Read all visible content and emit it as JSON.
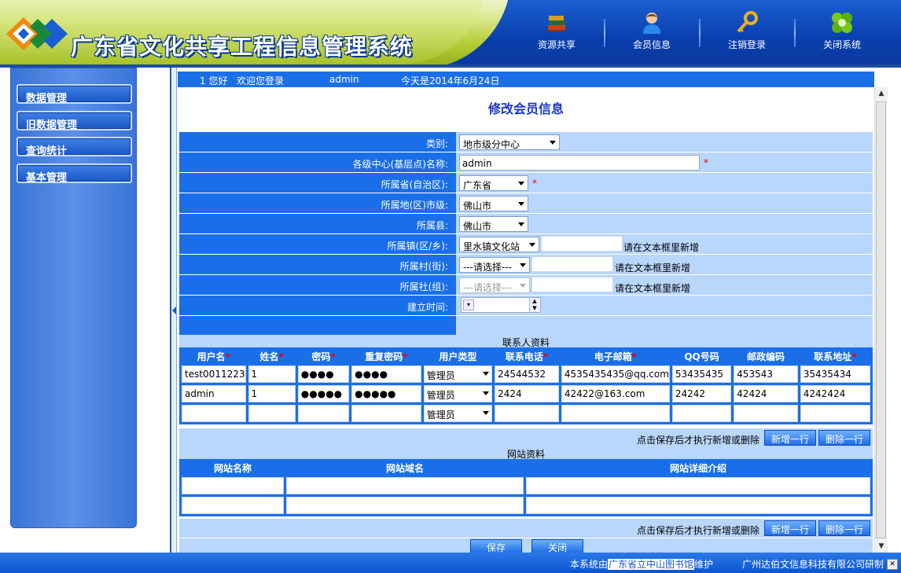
{
  "app": {
    "title": "广东省文化共享工程信息管理系统"
  },
  "topnav": [
    {
      "label": "资源共享",
      "icon": "books-icon"
    },
    {
      "label": "会员信息",
      "icon": "user-icon"
    },
    {
      "label": "注销登录",
      "icon": "key-icon"
    },
    {
      "label": "关闭系统",
      "icon": "close-system-icon"
    }
  ],
  "sidebar": {
    "items": [
      {
        "label": "数据管理"
      },
      {
        "label": "旧数据管理"
      },
      {
        "label": "查询统计"
      },
      {
        "label": "基本管理"
      }
    ]
  },
  "welcome": {
    "user_prefix": "1 您好",
    "greeting": "欢迎您登录",
    "username": "admin",
    "date": "今天是2014年6月24日"
  },
  "page": {
    "title": "修改会员信息"
  },
  "form": {
    "category_label": "类别:",
    "category_value": "地市级分中心",
    "center_name_label": "各级中心(基层点)名称:",
    "center_name_value": "admin",
    "province_label": "所属省(自治区):",
    "province_value": "广东省",
    "city_label": "所属地(区)市级:",
    "city_value": "佛山市",
    "county_label": "所属县:",
    "county_value": "佛山市",
    "town_label": "所属镇(区/乡):",
    "town_value": "里水镇文化站",
    "village_label": "所属村(街):",
    "village_value": "---请选择---",
    "community_label": "所属社(组):",
    "community_value": "---请选择---",
    "established_label": "建立时间:",
    "add_hint": "请在文本框里新增",
    "required_mark": "*"
  },
  "contacts": {
    "section_title": "联系人资料",
    "headers": [
      "用户名",
      "姓名",
      "密码",
      "重复密码",
      "用户类型",
      "联系电话",
      "电子邮箱",
      "QQ号码",
      "邮政编码",
      "联系地址"
    ],
    "required_cols": [
      true,
      true,
      true,
      true,
      false,
      true,
      true,
      false,
      false,
      true
    ],
    "rows": [
      [
        "test0011223",
        "1",
        "●●●●",
        "●●●●",
        "管理员",
        "24544532",
        "4535435435@qq.com",
        "53435435",
        "453543",
        "35435434"
      ],
      [
        "admin",
        "1",
        "●●●●●",
        "●●●●●",
        "管理员",
        "2424",
        "42422@163.com",
        "24242",
        "42424",
        "4242424"
      ],
      [
        "",
        "",
        "",
        "",
        "管理员",
        "",
        "",
        "",
        "",
        ""
      ]
    ],
    "action_hint": "点击保存后才执行新增或删除",
    "add_row_label": "新增一行",
    "delete_row_label": "删除一行"
  },
  "websites": {
    "section_title": "网站资料",
    "headers": [
      "网站名称",
      "网站域名",
      "网站详细介绍"
    ],
    "action_hint": "点击保存后才执行新增或删除",
    "add_row_label": "新增一行",
    "delete_row_label": "删除一行"
  },
  "buttons": {
    "save": "保存",
    "close": "关闭"
  },
  "footer": {
    "maintained_prefix": "本系统由",
    "library": "广东省立中山图书馆",
    "maintained_suffix": "维护",
    "developer": "广州达伯文信息科技有限公司研制"
  },
  "colors": {
    "header_blue": "#0a3fae",
    "accent_blue": "#1a6fe8",
    "row_light": "#b9d6fb",
    "title_blue": "#1a38c0",
    "required_red": "#e00000"
  }
}
